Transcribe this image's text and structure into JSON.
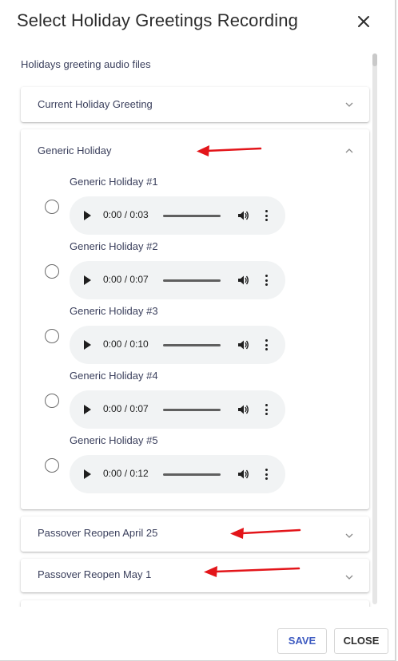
{
  "dialog": {
    "title": "Select Holiday Greetings Recording",
    "section_label": "Holidays greeting audio files",
    "panels": [
      {
        "title": "Current Holiday Greeting",
        "expanded": false
      },
      {
        "title": "Generic Holiday",
        "expanded": true,
        "recordings": [
          {
            "label": "Generic Holiday #1",
            "time": "0:00 / 0:03",
            "selected": false
          },
          {
            "label": "Generic Holiday #2",
            "time": "0:00 / 0:07",
            "selected": false
          },
          {
            "label": "Generic Holiday #3",
            "time": "0:00 / 0:10",
            "selected": false
          },
          {
            "label": "Generic Holiday #4",
            "time": "0:00 / 0:07",
            "selected": false
          },
          {
            "label": "Generic Holiday #5",
            "time": "0:00 / 0:12",
            "selected": false
          }
        ]
      },
      {
        "title": "Passover Reopen April 25",
        "expanded": false
      },
      {
        "title": "Passover Reopen May 1",
        "expanded": false
      }
    ],
    "footer": {
      "save_label": "SAVE",
      "close_label": "CLOSE"
    }
  },
  "colors": {
    "accent": "#3e5bc1",
    "annotation_arrow": "#e3151a",
    "player_bg": "#f1f3f4"
  },
  "icons": {
    "close": "close-icon",
    "chevron_down": "chevron-down-icon",
    "chevron_up": "chevron-up-icon",
    "play": "play-icon",
    "volume": "volume-icon",
    "more": "more-vertical-icon"
  }
}
